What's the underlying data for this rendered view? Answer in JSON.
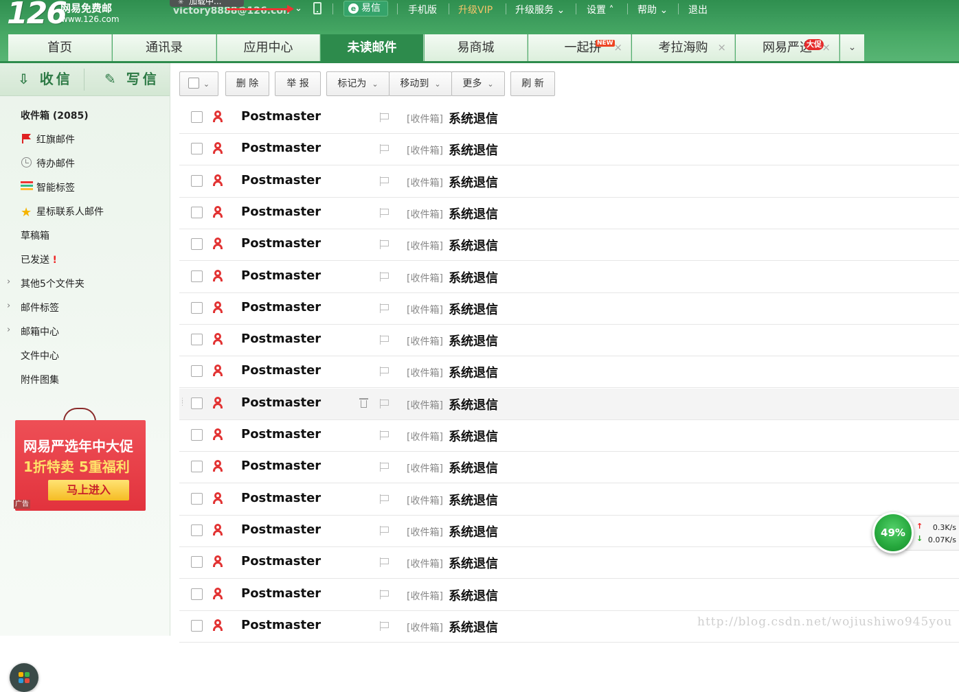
{
  "header": {
    "logo_number": "126",
    "logo_name": "网易免费邮",
    "logo_url": "www.126.com",
    "loading_text": "加载中...",
    "account": "victory8888@126.com",
    "yixin_label": "易信",
    "links": [
      "手机版",
      "升级VIP",
      "升级服务",
      "设置",
      "帮助",
      "退出"
    ]
  },
  "tabs": [
    {
      "label": "首页"
    },
    {
      "label": "通讯录"
    },
    {
      "label": "应用中心"
    },
    {
      "label": "未读邮件",
      "active": true
    },
    {
      "label": "易商城"
    },
    {
      "label": "一起拼",
      "badge": "NEW"
    },
    {
      "label": "考拉海购"
    },
    {
      "label": "网易严选",
      "badge": "大促"
    }
  ],
  "sidebar": {
    "receive_label": "收信",
    "write_label": "写信",
    "folders": [
      {
        "label": "收件箱 (2085)"
      },
      {
        "label": "红旗邮件",
        "icon": "flag-icon"
      },
      {
        "label": "待办邮件",
        "icon": "clock-icon"
      },
      {
        "label": "智能标签",
        "icon": "tag-icon"
      },
      {
        "label": "星标联系人邮件",
        "icon": "star-icon"
      },
      {
        "label": "草稿箱"
      },
      {
        "label": "已发送",
        "alert": "!"
      },
      {
        "label": "其他5个文件夹",
        "expandable": true
      },
      {
        "label": "邮件标签",
        "expandable": true
      },
      {
        "label": "邮箱中心",
        "expandable": true
      },
      {
        "label": "文件中心"
      },
      {
        "label": "附件图集"
      }
    ],
    "ad": {
      "line1": "网易严选年中大促",
      "line2": "1折特卖 5重福利",
      "button": "马上进入",
      "tag": "广告"
    }
  },
  "toolbar": {
    "delete": "删 除",
    "report": "举 报",
    "mark_as": "标记为",
    "move_to": "移动到",
    "more": "更多",
    "refresh": "刷 新"
  },
  "mails": [
    {
      "sender": "Postmaster",
      "folder": "[收件箱]",
      "subject": "系统退信"
    },
    {
      "sender": "Postmaster",
      "folder": "[收件箱]",
      "subject": "系统退信"
    },
    {
      "sender": "Postmaster",
      "folder": "[收件箱]",
      "subject": "系统退信"
    },
    {
      "sender": "Postmaster",
      "folder": "[收件箱]",
      "subject": "系统退信"
    },
    {
      "sender": "Postmaster",
      "folder": "[收件箱]",
      "subject": "系统退信"
    },
    {
      "sender": "Postmaster",
      "folder": "[收件箱]",
      "subject": "系统退信"
    },
    {
      "sender": "Postmaster",
      "folder": "[收件箱]",
      "subject": "系统退信"
    },
    {
      "sender": "Postmaster",
      "folder": "[收件箱]",
      "subject": "系统退信"
    },
    {
      "sender": "Postmaster",
      "folder": "[收件箱]",
      "subject": "系统退信"
    },
    {
      "sender": "Postmaster",
      "folder": "[收件箱]",
      "subject": "系统退信",
      "hover": true
    },
    {
      "sender": "Postmaster",
      "folder": "[收件箱]",
      "subject": "系统退信"
    },
    {
      "sender": "Postmaster",
      "folder": "[收件箱]",
      "subject": "系统退信"
    },
    {
      "sender": "Postmaster",
      "folder": "[收件箱]",
      "subject": "系统退信"
    },
    {
      "sender": "Postmaster",
      "folder": "[收件箱]",
      "subject": "系统退信"
    },
    {
      "sender": "Postmaster",
      "folder": "[收件箱]",
      "subject": "系统退信"
    },
    {
      "sender": "Postmaster",
      "folder": "[收件箱]",
      "subject": "系统退信"
    },
    {
      "sender": "Postmaster",
      "folder": "[收件箱]",
      "subject": "系统退信"
    }
  ],
  "net_widget": {
    "percent": "49%",
    "upload": "0.3K/s",
    "download": "0.07K/s"
  },
  "watermark": "http://blog.csdn.net/wojiushiwo945you",
  "colors": {
    "brand_green": "#2d8b4c",
    "unread_red": "#e23333",
    "vip_gold": "#f6c46a"
  }
}
